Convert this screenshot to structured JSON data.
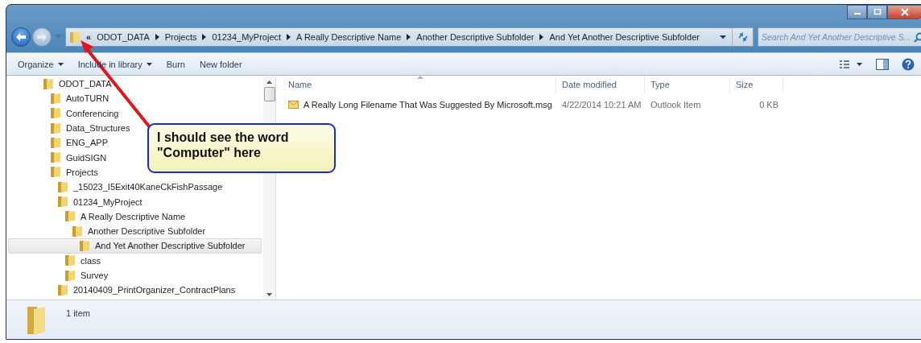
{
  "address_bar": {
    "overflow": "«",
    "crumbs": [
      "ODOT_DATA",
      "Projects",
      "01234_MyProject",
      "A Really Descriptive Name",
      "Another Descriptive Subfolder",
      "And Yet Another Descriptive Subfolder"
    ]
  },
  "search": {
    "placeholder": "Search And Yet Another Descriptive S..."
  },
  "toolbar": [
    {
      "label": "Organize",
      "dropdown": true
    },
    {
      "label": "Include in library",
      "dropdown": true
    },
    {
      "label": "Burn",
      "dropdown": false
    },
    {
      "label": "New folder",
      "dropdown": false
    }
  ],
  "tree": [
    {
      "label": "ODOT_DATA",
      "selected": false,
      "children": [
        {
          "label": "AutoTURN",
          "selected": false
        },
        {
          "label": "Conferencing",
          "selected": false
        },
        {
          "label": "Data_Structures",
          "selected": false
        },
        {
          "label": "ENG_APP",
          "selected": false
        },
        {
          "label": "GuidSIGN",
          "selected": false
        },
        {
          "label": "Projects",
          "selected": false,
          "children": [
            {
              "label": "_15023_I5Exit40KaneCkFishPassage",
              "selected": false
            },
            {
              "label": "01234_MyProject",
              "selected": false,
              "children": [
                {
                  "label": "A Really Descriptive Name",
                  "selected": false,
                  "children": [
                    {
                      "label": "Another Descriptive Subfolder",
                      "selected": false,
                      "children": [
                        {
                          "label": "And Yet Another Descriptive Subfolder",
                          "selected": true
                        }
                      ]
                    }
                  ]
                },
                {
                  "label": "class",
                  "selected": false
                },
                {
                  "label": "Survey",
                  "selected": false
                }
              ]
            },
            {
              "label": "20140409_PrintOrganizer_ContractPlans",
              "selected": false
            }
          ]
        }
      ]
    }
  ],
  "columns": [
    "Name",
    "Date modified",
    "Type",
    "Size"
  ],
  "files": [
    {
      "name": "A Really Long Filename That Was Suggested By Microsoft.msg",
      "date": "4/22/2014 10:21 AM",
      "type": "Outlook Item",
      "size": "0 KB"
    }
  ],
  "status_bar": {
    "count": "1 item"
  },
  "callout": {
    "text": "I should see the word \"Computer\" here"
  }
}
